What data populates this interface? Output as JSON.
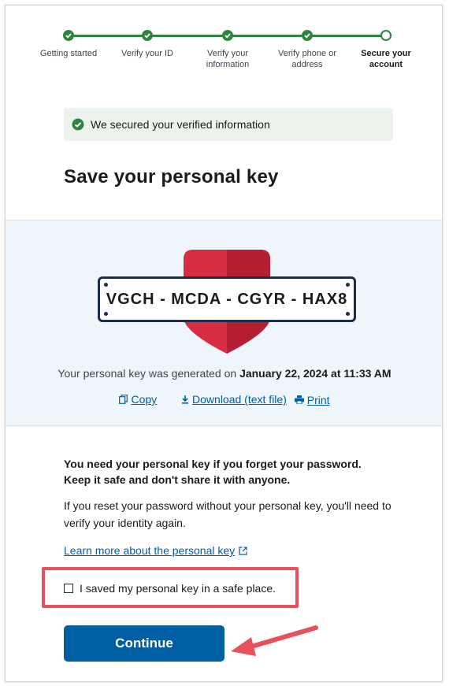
{
  "steps": [
    {
      "label": "Getting started",
      "status": "complete"
    },
    {
      "label": "Verify your ID",
      "status": "complete"
    },
    {
      "label": "Verify your information",
      "status": "complete"
    },
    {
      "label": "Verify phone or address",
      "status": "complete"
    },
    {
      "label": "Secure your account",
      "status": "current"
    }
  ],
  "alert": {
    "text": "We secured your verified information",
    "icon": "check-circle-icon"
  },
  "page_title": "Save your personal key",
  "personal_key": "VGCH - MCDA - CGYR - HAX8",
  "generated": {
    "prefix": "Your personal key was generated on",
    "datetime": "January 22, 2024 at 11:33 AM"
  },
  "actions": {
    "copy": "Copy",
    "download": "Download (text file)",
    "print": "Print"
  },
  "info": {
    "strong_line1": "You need your personal key if you forget your password.",
    "strong_line2": "Keep it safe and don't share it with anyone.",
    "para": "If you reset your password without your personal key, you'll need to verify your identity again.",
    "learn_more": "Learn more about the personal key"
  },
  "checkbox_label": "I saved my personal key in a safe place.",
  "continue_label": "Continue",
  "colors": {
    "success": "#2e8540",
    "primary": "#005ea2",
    "alert_bg": "#ecf3ec",
    "key_bg": "#eef6fb",
    "shield_red": "#d72d42",
    "highlight": "#e8515c"
  }
}
